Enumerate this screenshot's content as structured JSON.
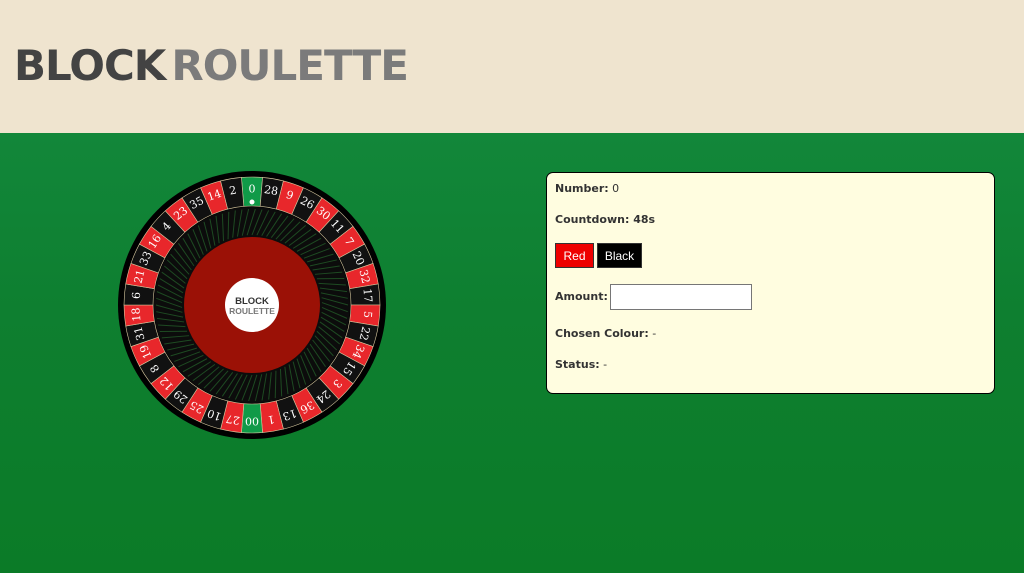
{
  "header": {
    "logo_part1": "BLOCK",
    "logo_part2": "ROULETTE"
  },
  "wheel": {
    "center_line1": "BLOCK",
    "center_line2": "ROULETTE",
    "pockets": [
      {
        "n": "0",
        "c": "green"
      },
      {
        "n": "28",
        "c": "black"
      },
      {
        "n": "9",
        "c": "red"
      },
      {
        "n": "26",
        "c": "black"
      },
      {
        "n": "30",
        "c": "red"
      },
      {
        "n": "11",
        "c": "black"
      },
      {
        "n": "7",
        "c": "red"
      },
      {
        "n": "20",
        "c": "black"
      },
      {
        "n": "32",
        "c": "red"
      },
      {
        "n": "17",
        "c": "black"
      },
      {
        "n": "5",
        "c": "red"
      },
      {
        "n": "22",
        "c": "black"
      },
      {
        "n": "34",
        "c": "red"
      },
      {
        "n": "15",
        "c": "black"
      },
      {
        "n": "3",
        "c": "red"
      },
      {
        "n": "24",
        "c": "black"
      },
      {
        "n": "36",
        "c": "red"
      },
      {
        "n": "13",
        "c": "black"
      },
      {
        "n": "1",
        "c": "red"
      },
      {
        "n": "00",
        "c": "green"
      },
      {
        "n": "27",
        "c": "red"
      },
      {
        "n": "10",
        "c": "black"
      },
      {
        "n": "25",
        "c": "red"
      },
      {
        "n": "29",
        "c": "black"
      },
      {
        "n": "12",
        "c": "red"
      },
      {
        "n": "8",
        "c": "black"
      },
      {
        "n": "19",
        "c": "red"
      },
      {
        "n": "31",
        "c": "black"
      },
      {
        "n": "18",
        "c": "red"
      },
      {
        "n": "6",
        "c": "black"
      },
      {
        "n": "21",
        "c": "red"
      },
      {
        "n": "33",
        "c": "black"
      },
      {
        "n": "16",
        "c": "red"
      },
      {
        "n": "4",
        "c": "black"
      },
      {
        "n": "23",
        "c": "red"
      },
      {
        "n": "35",
        "c": "black"
      },
      {
        "n": "14",
        "c": "red"
      },
      {
        "n": "2",
        "c": "black"
      }
    ],
    "colors": {
      "red": "#e8272b",
      "black": "#111111",
      "green": "#109a48",
      "rim": "#000000",
      "bowl": "#9b1106",
      "hub": "#ffffff"
    }
  },
  "panel": {
    "number_label": "Number:",
    "number_value": "0",
    "countdown_label": "Countdown:",
    "countdown_value": "48s",
    "red_button": "Red",
    "black_button": "Black",
    "amount_label": "Amount:",
    "amount_value": "",
    "chosen_colour_label": "Chosen Colour:",
    "chosen_colour_value": "-",
    "status_label": "Status:",
    "status_value": "-"
  },
  "colors": {
    "header_bg": "#efe4cf",
    "table_green": "#0e7f30",
    "panel_bg": "#fffde0",
    "button_red": "#ee0000",
    "button_black": "#000000"
  }
}
